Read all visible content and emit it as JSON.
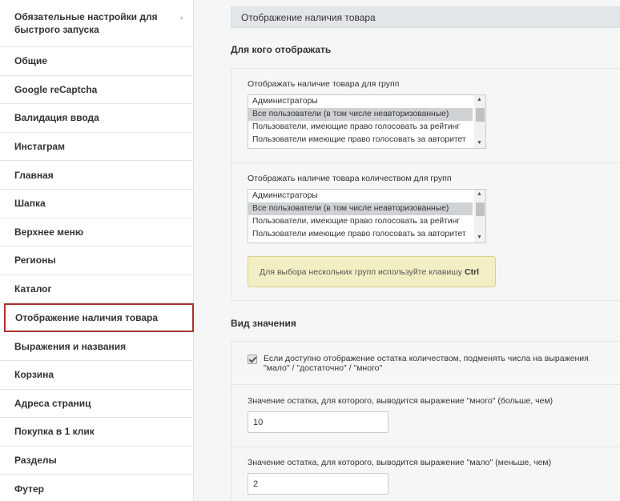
{
  "sidebar": {
    "items": [
      {
        "label": "Обязательные настройки для быстрого запуска",
        "marker": "*"
      },
      {
        "label": "Общие"
      },
      {
        "label": "Google reCaptcha"
      },
      {
        "label": "Валидация ввода"
      },
      {
        "label": "Инстаграм"
      },
      {
        "label": "Главная"
      },
      {
        "label": "Шапка"
      },
      {
        "label": "Верхнее меню"
      },
      {
        "label": "Регионы"
      },
      {
        "label": "Каталог"
      },
      {
        "label": "Отображение наличия товара"
      },
      {
        "label": "Выражения и названия"
      },
      {
        "label": "Корзина"
      },
      {
        "label": "Адреса страниц"
      },
      {
        "label": "Покупка в 1 клик"
      },
      {
        "label": "Разделы"
      },
      {
        "label": "Футер"
      }
    ],
    "active_index": 10
  },
  "main": {
    "header": "Отображение наличия товара",
    "who_title": "Для кого отображать",
    "groups_label": "Отображать наличие товара для групп",
    "groups_qty_label": "Отображать наличие товара количеством для групп",
    "options": [
      "Администраторы",
      "Все пользователи (в том числе неавторизованные)",
      "Пользователи, имеющие право голосовать за рейтинг",
      "Пользователи имеющие право голосовать за авторитет"
    ],
    "selected_option_index": 1,
    "hint_text": "Для выбора нескольких групп используйте клавишу",
    "hint_key": "Ctrl",
    "value_title": "Вид значения",
    "checkbox_label": "Если доступно отображение остатка количеством, подменять числа на выражения \"мало\" / \"достаточно\" / \"много\"",
    "checkbox_checked": true,
    "many_label": "Значение остатка, для которого, выводится выражение \"много\" (больше, чем)",
    "many_value": "10",
    "few_label": "Значение остатка, для которого, выводится выражение \"мало\" (меньше, чем)",
    "few_value": "2"
  }
}
